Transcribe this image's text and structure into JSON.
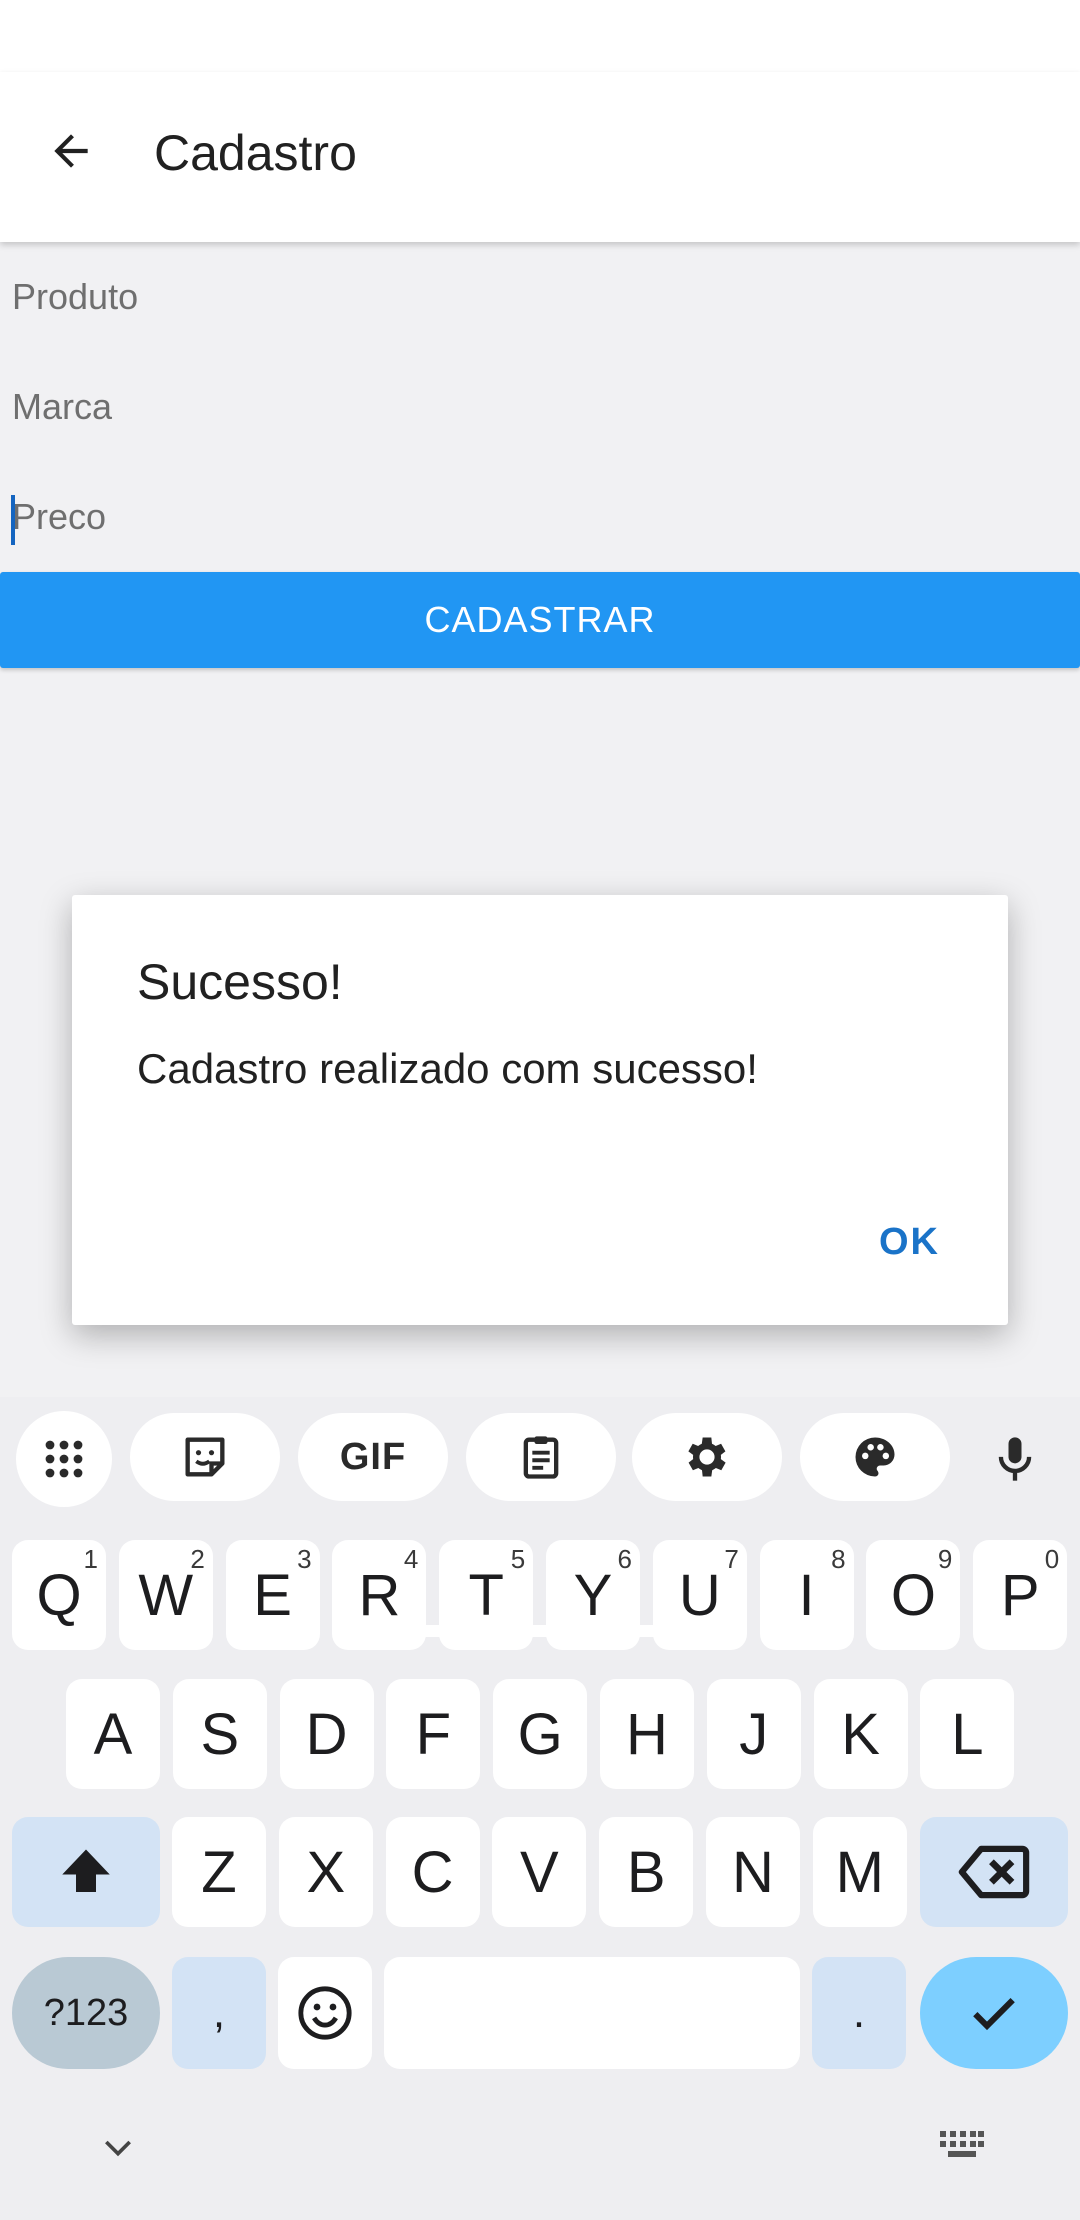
{
  "app_bar": {
    "title": "Cadastro",
    "back_icon": "arrow-back-icon"
  },
  "form": {
    "produto_placeholder": "Produto",
    "marca_placeholder": "Marca",
    "preco_placeholder": "Preco",
    "submit_label": "CADASTRAR",
    "accent_color": "#2196f3"
  },
  "dialog": {
    "title": "Sucesso!",
    "message": "Cadastro realizado com sucesso!",
    "ok_label": "OK"
  },
  "keyboard": {
    "toolbar": [
      "apps-grid-icon",
      "sticker-icon",
      "GIF",
      "clipboard-icon",
      "settings-gear-icon",
      "palette-icon",
      "microphone-icon"
    ],
    "row1": [
      {
        "k": "Q",
        "h": "1"
      },
      {
        "k": "W",
        "h": "2"
      },
      {
        "k": "E",
        "h": "3"
      },
      {
        "k": "R",
        "h": "4"
      },
      {
        "k": "T",
        "h": "5"
      },
      {
        "k": "Y",
        "h": "6"
      },
      {
        "k": "U",
        "h": "7"
      },
      {
        "k": "I",
        "h": "8"
      },
      {
        "k": "O",
        "h": "9"
      },
      {
        "k": "P",
        "h": "0"
      }
    ],
    "row2": [
      "A",
      "S",
      "D",
      "F",
      "G",
      "H",
      "J",
      "K",
      "L"
    ],
    "row3": [
      "Z",
      "X",
      "C",
      "V",
      "B",
      "N",
      "M"
    ],
    "symbols_label": "?123",
    "comma_label": ",",
    "period_label": ".",
    "gif_label": "GIF"
  }
}
